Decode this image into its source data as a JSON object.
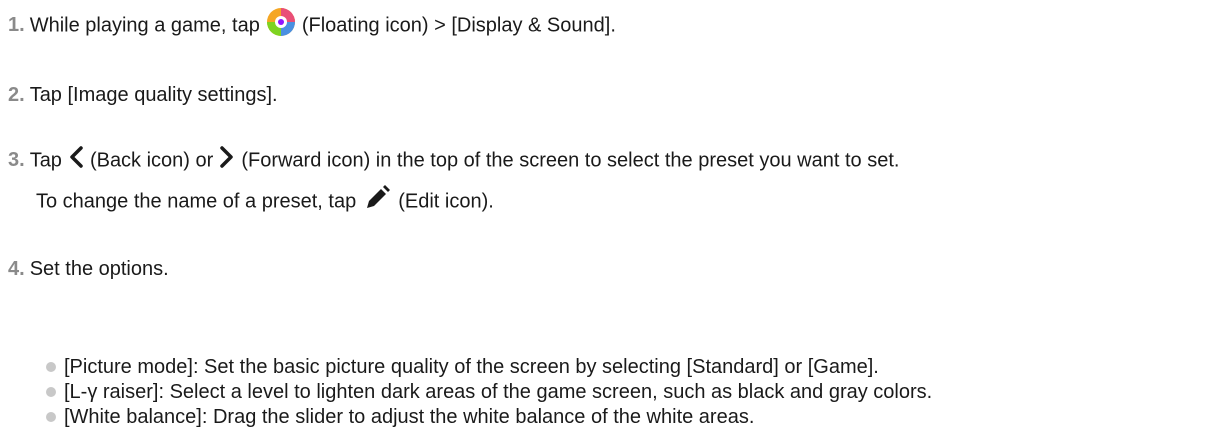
{
  "steps": [
    {
      "num": "1.",
      "before": "While playing a game, tap",
      "icon": "floating-icon",
      "after": "(Floating icon) > [Display & Sound]."
    },
    {
      "num": "2.",
      "text": "Tap [Image quality settings]."
    },
    {
      "num": "3.",
      "part1": "Tap",
      "icon1": "back-icon",
      "part2": "(Back icon) or",
      "icon2": "forward-icon",
      "part3": "(Forward icon) in the top of the screen to select the preset you want to set.",
      "line2_before": "To change the name of a preset, tap",
      "icon3": "edit-icon",
      "line2_after": "(Edit icon)."
    },
    {
      "num": "4.",
      "text": "Set the options.",
      "bullets": [
        "[Picture mode]: Set the basic picture quality of the screen by selecting [Standard] or [Game].",
        "[L-γ raiser]: Select a level to lighten dark areas of the game screen, such as black and gray colors.",
        "[White balance]: Drag the slider to adjust the white balance of the white areas."
      ]
    }
  ],
  "colors": {
    "text": "#1a1a1a",
    "number": "#8a8a8a",
    "bullet": "#c8c8c8"
  }
}
